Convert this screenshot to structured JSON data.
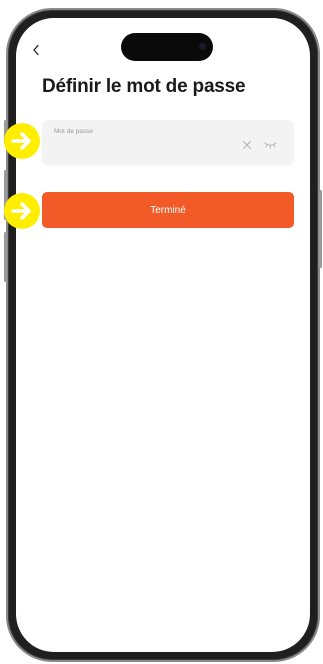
{
  "page": {
    "title": "Définir le mot de passe"
  },
  "password_field": {
    "label": "Mot de passe",
    "value": "",
    "placeholder": ""
  },
  "buttons": {
    "done_label": "Terminé"
  },
  "icons": {
    "back": "chevron-left-icon",
    "clear": "close-icon",
    "visibility": "eye-closed-icon",
    "annotation": "arrow-right-icon"
  },
  "colors": {
    "accent": "#f25a28",
    "annotation": "#ffee00",
    "field_bg": "#f3f3f3"
  }
}
